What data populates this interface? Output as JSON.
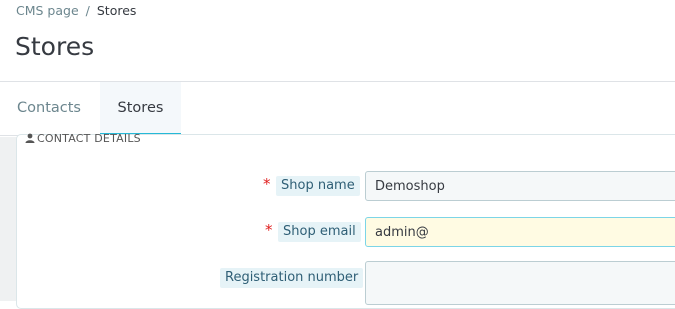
{
  "breadcrumb": {
    "items": [
      "CMS page",
      "Stores"
    ],
    "separator": "/"
  },
  "page": {
    "title": "Stores"
  },
  "tabs": [
    {
      "label": "Contacts",
      "active": false
    },
    {
      "label": "Stores",
      "active": true
    }
  ],
  "panel": {
    "heading": "CONTACT DETAILS",
    "icon": "user-icon"
  },
  "form": {
    "shop_name": {
      "label": "Shop name",
      "required": true,
      "value": "Demoshop"
    },
    "shop_email": {
      "label": "Shop email",
      "required": true,
      "value": "admin@"
    },
    "registration_number": {
      "label": "Registration number",
      "required": false,
      "value": ""
    },
    "required_marker": "*"
  },
  "colors": {
    "accent": "#25b9d7",
    "required": "#e02020",
    "label_bg": "#e6f3f7",
    "focused_field_bg": "#fffbe3"
  }
}
